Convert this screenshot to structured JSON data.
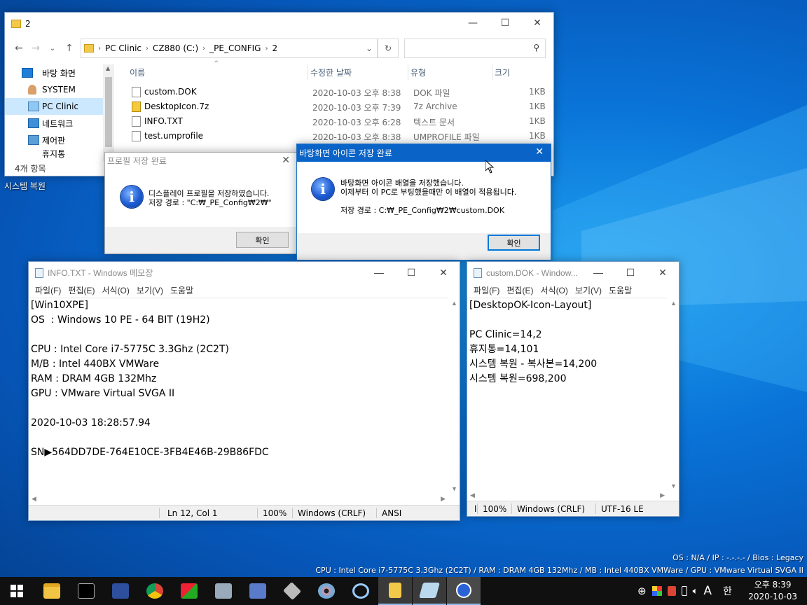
{
  "desktop": {
    "icon_label": "시스템 복원",
    "overlay_line1": "OS : N/A / IP : -.-.-.- / Bios : Legacy",
    "overlay_line2": "CPU : Intel Core i7-5775C 3.3Ghz (2C2T) / RAM : DRAM 4GB 132Mhz / MB : Intel 440BX VMWare / GPU : VMware Virtual SVGA II"
  },
  "explorer": {
    "title": "2",
    "breadcrumb": [
      "PC Clinic",
      "CZ880 (C:)",
      "_PE_CONFIG",
      "2"
    ],
    "search_placeholder": "",
    "nav": [
      {
        "label": "바탕 화면",
        "icon": "desktop-icon"
      },
      {
        "label": "SYSTEM",
        "icon": "user-icon"
      },
      {
        "label": "PC Clinic",
        "icon": "computer-icon",
        "selected": true
      },
      {
        "label": "네트워크",
        "icon": "network-icon"
      },
      {
        "label": "제어판",
        "icon": "control-panel-icon"
      },
      {
        "label": "휴지통",
        "icon": "recycle-bin-icon"
      }
    ],
    "columns": {
      "name": "이름",
      "modified": "수정한 날짜",
      "type": "유형",
      "size": "크기"
    },
    "files": [
      {
        "name": "custom.DOK",
        "modified": "2020-10-03 오후 8:38",
        "type": "DOK 파일",
        "size": "1KB",
        "icon": "file-icon"
      },
      {
        "name": "DesktopIcon.7z",
        "modified": "2020-10-03 오후 7:39",
        "type": "7z Archive",
        "size": "1KB",
        "icon": "archive-icon"
      },
      {
        "name": "INFO.TXT",
        "modified": "2020-10-03 오후 6:28",
        "type": "텍스트 문서",
        "size": "1KB",
        "icon": "text-file-icon"
      },
      {
        "name": "test.umprofile",
        "modified": "2020-10-03 오후 8:38",
        "type": "UMPROFILE 파일",
        "size": "1KB",
        "icon": "file-icon"
      }
    ],
    "status": "4개 항목"
  },
  "dialog_profile": {
    "title": "프로필 저장 완료",
    "message": "디스플레이 프로필을 저장하였습니다.\n저장 경로 : \"C:₩_PE_Config₩2₩\"",
    "ok_label": "확인"
  },
  "dialog_icons": {
    "title": "바탕화면 아이콘 저장 완료",
    "message": "바탕화면 아이콘 배열을 저장했습니다.\n이제부터 이 PC로 부팅했을때만 이 배열이 적용됩니다.\n\n저장 경로 : C:₩_PE_Config₩2₩custom.DOK",
    "ok_label": "확인"
  },
  "notepad_info": {
    "title": "INFO.TXT - Windows 메모장",
    "menu": [
      "파일(F)",
      "편집(E)",
      "서식(O)",
      "보기(V)",
      "도움말"
    ],
    "content": "[Win10XPE]\nOS  : Windows 10 PE - 64 BIT (19H2)\n\nCPU : Intel Core i7-5775C 3.3Ghz (2C2T)\nM/B : Intel 440BX VMWare\nRAM : DRAM 4GB 132Mhz\nGPU : VMware Virtual SVGA II\n\n2020-10-03 18:28:57.94\n\nSN▶564DD7DE-764E10CE-3FB4E46B-29B86FDC",
    "status": {
      "position": "Ln 12, Col 1",
      "zoom": "100%",
      "eol": "Windows (CRLF)",
      "encoding": "ANSI"
    }
  },
  "notepad_dok": {
    "title": "custom.DOK - Window...",
    "menu": [
      "파일(F)",
      "편집(E)",
      "서식(O)",
      "보기(V)",
      "도움말"
    ],
    "content": "[DesktopOK-Icon-Layout]\n\nPC Clinic=14,2\n휴지통=14,101\n시스템 복원 - 복사본=14,200\n시스템 복원=698,200",
    "status": {
      "position": "l",
      "zoom": "100%",
      "eol": "Windows (CRLF)",
      "encoding": "UTF-16 LE"
    }
  },
  "taskbar": {
    "items": [
      "start-icon",
      "file-explorer-icon",
      "command-prompt-icon",
      "save-icon",
      "chrome-icon",
      "app-icon",
      "network-tool-icon",
      "system-tool-icon",
      "disk-tool-icon",
      "cd-icon",
      "search-tool-icon",
      "folder-icon",
      "notepad-icon",
      "info-dialog-icon"
    ],
    "ime": "A",
    "lang": "한",
    "time": "오후 8:39",
    "date": "2020-10-03"
  }
}
